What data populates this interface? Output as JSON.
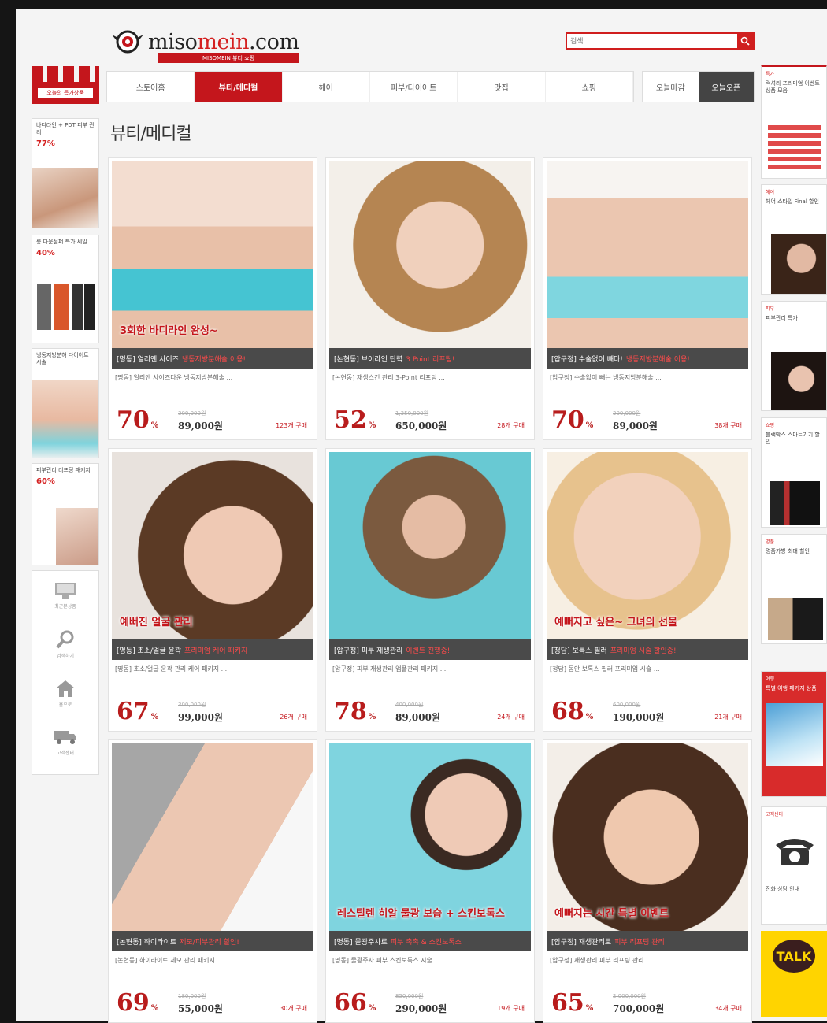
{
  "header": {
    "logo_prefix": "miso",
    "logo_red": "mein",
    "logo_suffix": ".com",
    "logo_tagline": "MISOMEIN 뷰티 쇼핑",
    "search_placeholder": "검색"
  },
  "nav": {
    "items": [
      "스토어홈",
      "뷰티/메디컬",
      "헤어",
      "피부/다이어트",
      "맛집",
      "쇼핑"
    ],
    "active_index": 1,
    "right_items": [
      "오늘마감",
      "오늘오픈"
    ]
  },
  "page_title": "뷰티/메디컬",
  "left_sidebar": {
    "sale_label": "오늘의 특가상품",
    "ads": [
      {
        "text": "바디라인 + PDT 피부 관리",
        "percent": "77%"
      },
      {
        "text": "롱 다운점퍼 특가 세일",
        "percent": "40%"
      },
      {
        "text": "냉동지방분해 다이어트 시술",
        "percent": ""
      },
      {
        "text": "피부관리 리프팅 패키지",
        "percent": "60%"
      }
    ],
    "icons": [
      {
        "icon": "monitor-icon",
        "label": "최근본상품"
      },
      {
        "icon": "magnifier-icon",
        "label": "검색하기"
      },
      {
        "icon": "home-icon",
        "label": "홈으로"
      },
      {
        "icon": "truck-icon",
        "label": "고객센터"
      }
    ]
  },
  "right_sidebar": {
    "ads": [
      {
        "head": "특가",
        "text": "럭셔리 프리미엄 이벤트 상품 모음"
      },
      {
        "head": "헤어",
        "text": "헤어 스타일 Final 할인"
      },
      {
        "head": "피부",
        "text": "피부관리 특가"
      },
      {
        "head": "쇼핑",
        "text": "블랙박스 스마트기기 할인"
      },
      {
        "head": "명품",
        "text": "명품가방 최대 할인"
      },
      {
        "head": "여행",
        "text": "특별 여행 패키지 상품"
      },
      {
        "head": "고객센터",
        "text": "전화 상담 안내"
      },
      {
        "head": "",
        "text": "TALK"
      }
    ]
  },
  "products": [
    {
      "band": "[명동] 얼리엔 사이즈",
      "band_hl": "냉동지방분해술 이용!",
      "desc": "[명동] 얼리엔 사이즈다운 냉동지방분해술 ...",
      "discount": "70",
      "old": "300,000원",
      "price": "89,000원",
      "sold": "123개 구매",
      "sticker": "3회한 바디라인 완성~"
    },
    {
      "band": "[논현동] 브이라인 탄력",
      "band_hl": "3 Point 리프팅!",
      "desc": "[논현동] 재생스킨 관리 3-Point 리프팅 ...",
      "discount": "52",
      "old": "1,350,000원",
      "price": "650,000원",
      "sold": "28개 구매",
      "sticker": ""
    },
    {
      "band": "[압구정] 수술없이 빼다!",
      "band_hl": "냉동지방분해술 이용!",
      "desc": "[압구정] 수술없이 빼는 냉동지방분해술 ...",
      "discount": "70",
      "old": "300,000원",
      "price": "89,000원",
      "sold": "38개 구매",
      "sticker": ""
    },
    {
      "band": "[명동] 초소/얼굴 윤곽",
      "band_hl": "프리미엄 케어 패키지",
      "desc": "[명동] 초소/얼굴 윤곽 관리 케어 패키지 ...",
      "discount": "67",
      "old": "300,000원",
      "price": "99,000원",
      "sold": "26개 구매",
      "sticker": "예뻐진 얼굴 관리"
    },
    {
      "band": "[압구정] 피부 재생관리",
      "band_hl": "이벤트 진행중!",
      "desc": "[압구정] 피부 재생관리 앰플관리 패키지 ...",
      "discount": "78",
      "old": "400,000원",
      "price": "89,000원",
      "sold": "24개 구매",
      "sticker": ""
    },
    {
      "band": "[청담] 보톡스 필러",
      "band_hl": "프리미엄 시술 할인중!",
      "desc": "[청담] 동안 보톡스 필러 프리미엄 시술 ...",
      "discount": "68",
      "old": "600,000원",
      "price": "190,000원",
      "sold": "21개 구매",
      "sticker": "예뻐지고 싶은~ 그녀의 선물"
    },
    {
      "band": "[논현동] 하이라이트",
      "band_hl": "제모/피부관리 할인!",
      "desc": "[논현동] 하이라이트 제모 관리 패키지 ...",
      "discount": "69",
      "old": "180,000원",
      "price": "55,000원",
      "sold": "30개 구매",
      "sticker": ""
    },
    {
      "band": "[명동] 물광주사로",
      "band_hl": "피부 촉촉 & 스킨보톡스",
      "desc": "[명동] 물광주사 피부 스킨보톡스 시술 ...",
      "discount": "66",
      "old": "850,000원",
      "price": "290,000원",
      "sold": "19개 구매",
      "sticker": "레스틸렌 히알 물광 보습 + 스킨보톡스"
    },
    {
      "band": "[압구정] 재생관리로",
      "band_hl": "피부 리프팅 관리",
      "desc": "[압구정] 재생관리 피부 리프팅 관리 ...",
      "discount": "65",
      "old": "2,000,000원",
      "price": "700,000원",
      "sold": "34개 구매",
      "sticker": "예뻐지는 시간 특별 이벤트"
    }
  ],
  "colors": {
    "accent": "#c4161c",
    "background": "#151515",
    "page": "#f4f4f4"
  }
}
